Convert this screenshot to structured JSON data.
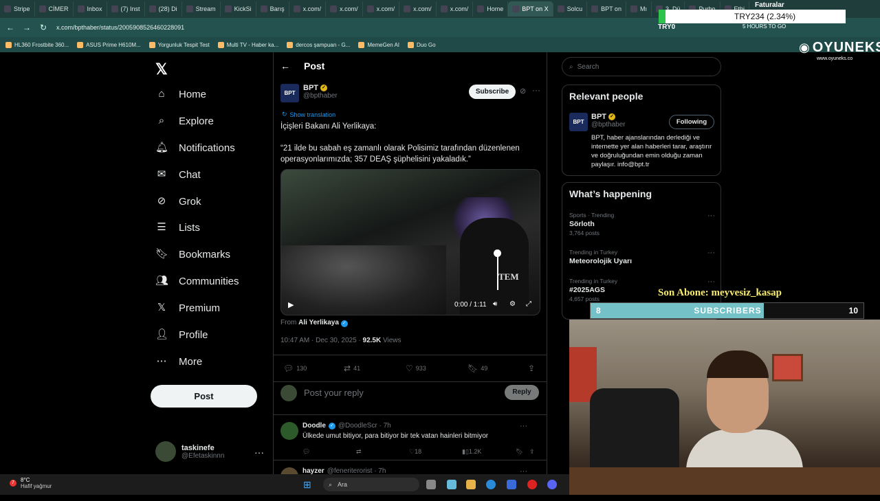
{
  "browser": {
    "tabs": [
      "Stripe",
      "CİMER",
      "Inbox",
      "(7) Inst",
      "(28) Di",
      "Stream",
      "KickSi",
      "Barış",
      "x.com/",
      "x.com/",
      "x.com/",
      "x.com/",
      "x.com/",
      "Home",
      "BPT on X",
      "Solcu",
      "BPT on",
      "Mı",
      "3. Dü",
      "Purbo",
      "Ethi"
    ],
    "url": "x.com/bpthaber/status/2005908526460228091",
    "bookmarks": [
      "HL360 Frostbite 360...",
      "ASUS Prime H610M...",
      "Yorgunluk Tespit Test",
      "Multi TV - Haber ka...",
      "dercos şampuan - G...",
      "MemeGen AI",
      "Duo Go"
    ],
    "right_text": "5 HOURS TO GO"
  },
  "overlay": {
    "currency": "TRY234 (2.34%)",
    "faturalar": "Faturalar",
    "try_label": "TRY0",
    "brand": "OYUNEKS",
    "brand_url": "www.oyuneks.co",
    "son_abone": "Son Abone: meyvesiz_kasap",
    "sub_current": "8",
    "sub_label": "SUBSCRIBERS",
    "sub_goal": "10",
    "sub_progress": 0.8
  },
  "nav": {
    "items": [
      {
        "label": "Home",
        "icon": "home-icon"
      },
      {
        "label": "Explore",
        "icon": "search-icon"
      },
      {
        "label": "Notifications",
        "icon": "bell-icon"
      },
      {
        "label": "Chat",
        "icon": "mail-icon"
      },
      {
        "label": "Grok",
        "icon": "grok-icon"
      },
      {
        "label": "Lists",
        "icon": "list-icon"
      },
      {
        "label": "Bookmarks",
        "icon": "bookmark-icon"
      },
      {
        "label": "Communities",
        "icon": "people-icon"
      },
      {
        "label": "Premium",
        "icon": "x-icon"
      },
      {
        "label": "Profile",
        "icon": "user-icon"
      },
      {
        "label": "More",
        "icon": "more-icon"
      }
    ],
    "post_label": "Post",
    "account_name": "taskinefe",
    "account_handle": "@Efetaskinnn"
  },
  "post": {
    "header_title": "Post",
    "author_name": "BPT",
    "author_handle": "@bpthaber",
    "author_logo": "BPT",
    "subscribe_label": "Subscribe",
    "show_translation": "Show translation",
    "line1": "İçişleri Bakanı Ali Yerlikaya:",
    "line2": "“21 ilde bu sabah eş zamanlı olarak Polisimiz tarafından düzenlenen operasyonlarımızda; 357 DEAŞ şüphelisini yakaladık.”",
    "video_time": "0:00 / 1:11",
    "video_text": "TEM",
    "from_prefix": "From",
    "from_name": "Ali Yerlikaya",
    "timestamp": "10:47 AM · Dec 30, 2025 ·",
    "views_count": "92.5K",
    "views_label": "Views",
    "replies": "130",
    "reposts": "41",
    "likes": "933",
    "bookmarks": "49",
    "reply_placeholder": "Post your reply",
    "reply_button": "Reply"
  },
  "comments": [
    {
      "name": "Doodle",
      "handle": "@DoodleScr · 7h",
      "text": "Ülkede umut bitiyor, para bitiyor bir tek vatan hainleri bitmiyor",
      "likes": "18",
      "views": "1.2K"
    },
    {
      "name": "hayzer",
      "handle": "@feneriterorist · 7h"
    }
  ],
  "right": {
    "search_placeholder": "Search",
    "relevant_title": "Relevant people",
    "rel_name": "BPT",
    "rel_handle": "@bpthaber",
    "following_label": "Following",
    "rel_bio": "BPT, haber ajanslarından derlediği ve internette yer alan haberleri tarar, araştırır ve doğruluğundan emin olduğu zaman paylaşır. info@bpt.tr",
    "happening_title": "What’s happening",
    "trends": [
      {
        "category": "Sports · Trending",
        "title": "Sörloth",
        "posts": "3,764 posts"
      },
      {
        "category": "Trending in Turkey",
        "title": "Meteorolojik Uyarı",
        "posts": ""
      },
      {
        "category": "Trending in Turkey",
        "title": "#2025AGS",
        "posts": "4,657 posts"
      }
    ]
  },
  "taskbar": {
    "badge": "7",
    "temp": "8°C",
    "weather": "Hafif yağmur",
    "search": "Ara"
  }
}
